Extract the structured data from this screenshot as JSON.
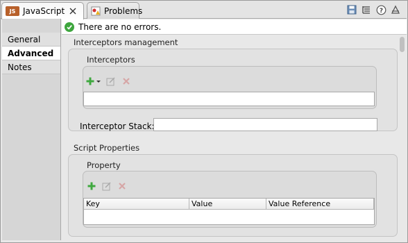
{
  "tabs": [
    {
      "label": "JavaScript",
      "icon": "js-file-icon",
      "active": true
    },
    {
      "label": "Problems",
      "icon": "problems-icon",
      "active": false
    }
  ],
  "js_badge": "JS",
  "toolbar_icons": [
    "save-icon",
    "outline-icon",
    "help-icon",
    "maximize-icon"
  ],
  "nav": {
    "items": [
      "General",
      "Advanced",
      "Notes"
    ],
    "selected": "Advanced"
  },
  "status": {
    "text": "There are no errors."
  },
  "interceptors_section": {
    "title": "Interceptors management",
    "group_title": "Interceptors",
    "stack_label": "Interceptor Stack:",
    "stack_value": ""
  },
  "script_properties": {
    "title": "Script Properties",
    "group_title": "Property",
    "columns": [
      "Key",
      "Value",
      "Value Reference"
    ],
    "rows": []
  },
  "colors": {
    "ok": "#3ea63e",
    "add": "#3fa83f",
    "remove": "#c84040"
  }
}
